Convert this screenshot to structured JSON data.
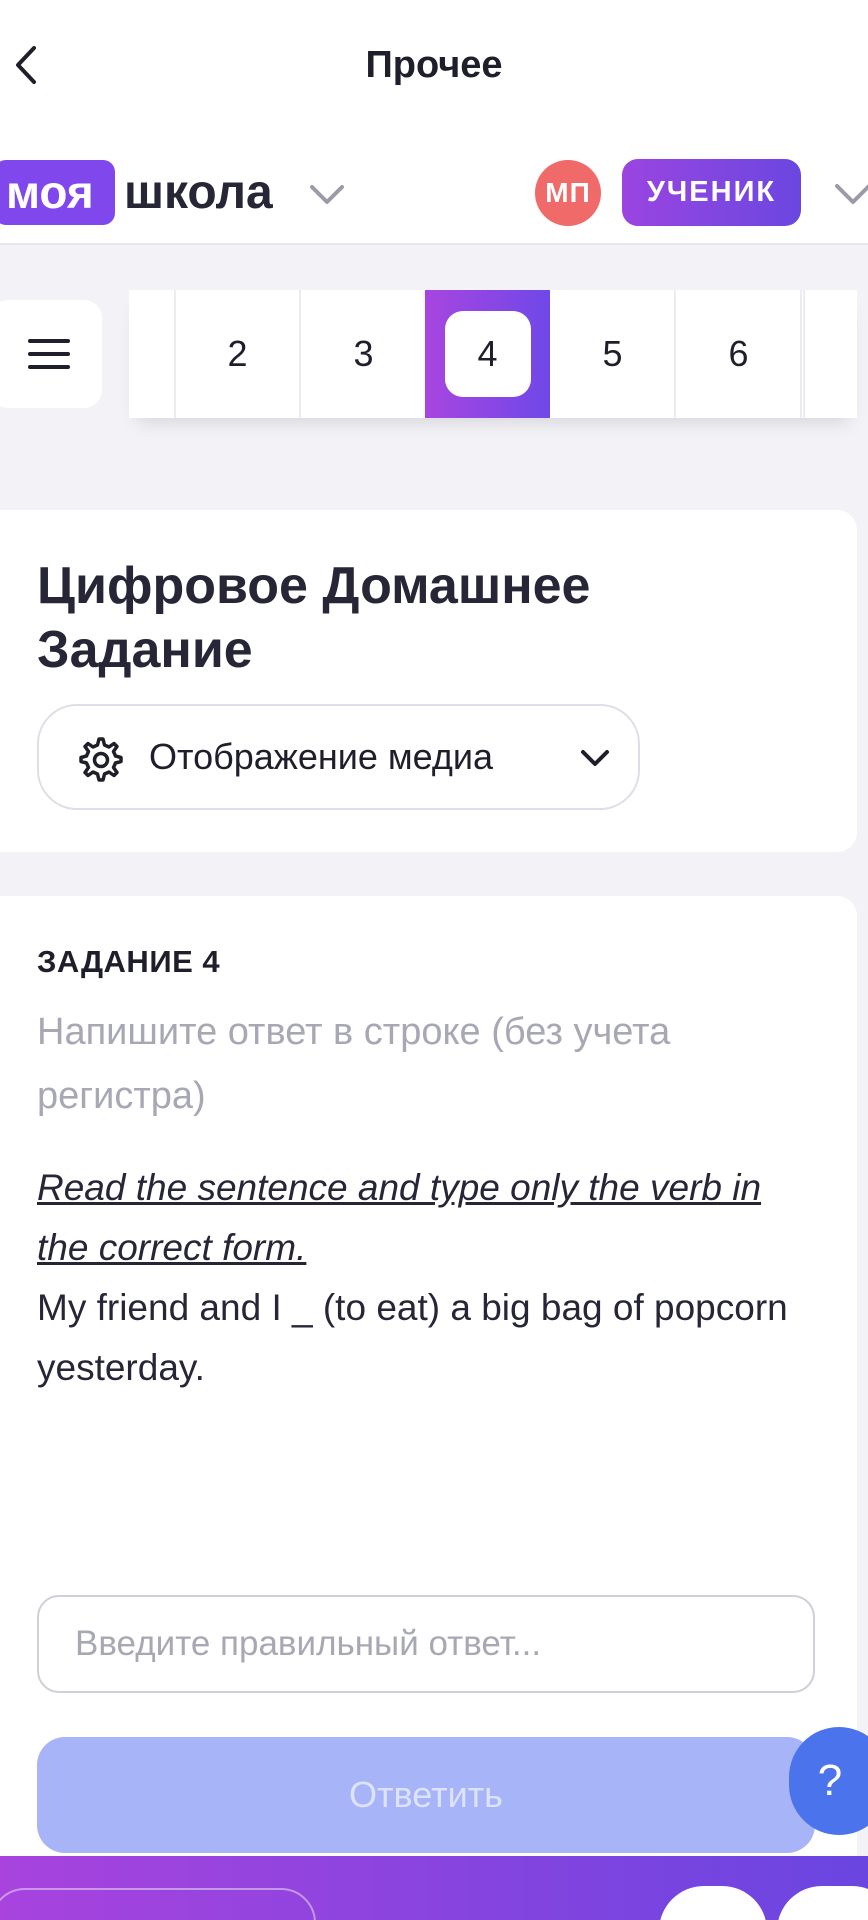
{
  "header": {
    "title": "Прочее"
  },
  "brand": {
    "part1": "моя",
    "part2": "школа",
    "accent_color": "#8048ec"
  },
  "user": {
    "initials": "МП",
    "role": "УЧЕНИК",
    "avatar_color": "#f06a6a"
  },
  "tasks_nav": {
    "items": [
      "2",
      "3",
      "4",
      "5",
      "6"
    ],
    "active": "4"
  },
  "homework": {
    "title": "Цифровое Домашнее Задание",
    "media_button_label": "Отображение медиа"
  },
  "task": {
    "label": "ЗАДАНИЕ 4",
    "hint": "Напишите ответ в строке (без учета регистра)",
    "instruction": "Read the sentence and type only the verb in the correct form.",
    "sentence": "My friend and I _ (to eat) a big bag of popcorn yesterday.",
    "answer_placeholder": "Введите правильный ответ...",
    "submit_label": "Ответить"
  },
  "help": {
    "label": "?"
  }
}
